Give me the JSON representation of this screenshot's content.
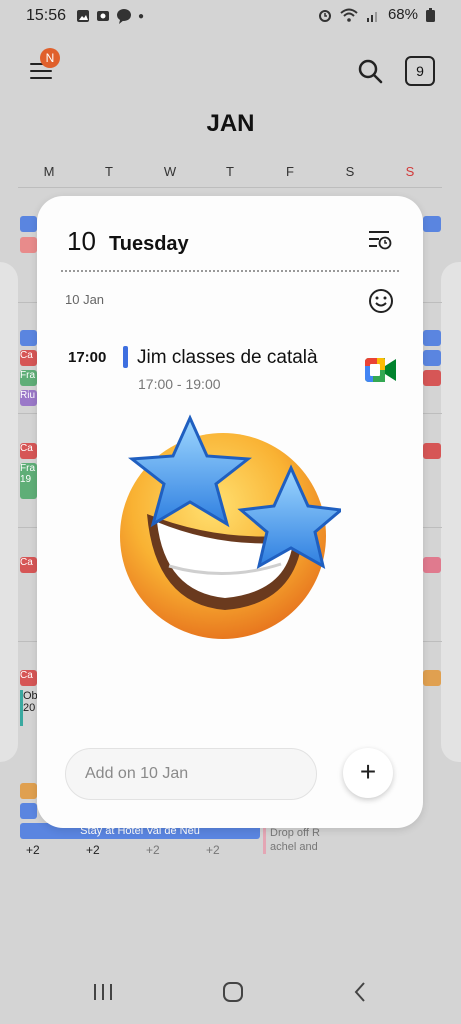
{
  "status_bar": {
    "time": "15:56",
    "battery": "68%"
  },
  "header": {
    "notification_badge": "N",
    "today_button": "9"
  },
  "calendar": {
    "month": "JAN",
    "weekdays": [
      "M",
      "T",
      "W",
      "T",
      "F",
      "S",
      "S"
    ],
    "events": [
      "Ca",
      "Fra",
      "Riu",
      "Ca",
      "Fra",
      "19",
      "Ca",
      "Ca",
      "Ob",
      "20"
    ],
    "stay_event": "Stay at Hotel Val de Neu",
    "drop_event_line1": "Drop off R",
    "drop_event_line2": "achel and",
    "more_counts": [
      "+2",
      "+2",
      "+2",
      "+2"
    ]
  },
  "popup": {
    "day_number": "10",
    "day_name": "Tuesday",
    "date_label": "10 Jan",
    "event": {
      "time": "17:00",
      "title": "Jim classes de català",
      "range": "17:00 - 19:00"
    },
    "add_placeholder": "Add on 10 Jan"
  },
  "colors": {
    "accent_blue": "#3e6fe0",
    "badge_orange": "#e0602c",
    "sunday_red": "#d23a3a"
  }
}
